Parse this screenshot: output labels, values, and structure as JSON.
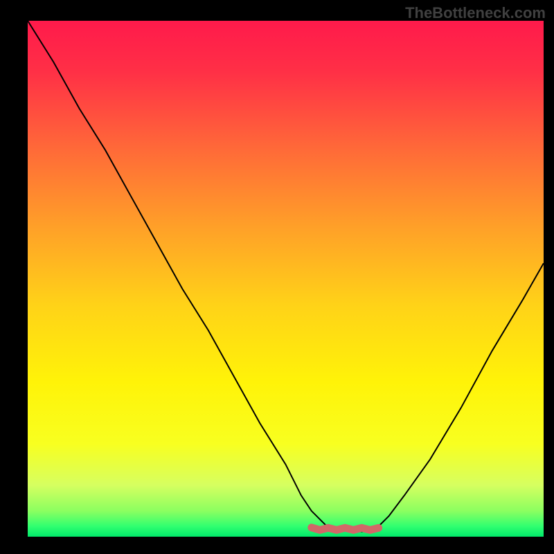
{
  "watermark": "TheBottleneck.com",
  "chart_data": {
    "type": "line",
    "title": "",
    "xlabel": "",
    "ylabel": "",
    "xlim": [
      0,
      100
    ],
    "ylim": [
      0,
      100
    ],
    "description": "Bottleneck severity curve over a red-to-green vertical gradient. Curve drops from top-left to a flat minimum near x≈58-68 then rises toward the right edge. A salmon band marks the flat minimum region. Background gradient encodes severity: red (high) at top → yellow mid → bright green (optimal) at bottom.",
    "series": [
      {
        "name": "bottleneck-severity",
        "x": [
          0,
          5,
          10,
          15,
          20,
          25,
          30,
          35,
          40,
          45,
          50,
          53,
          55,
          58,
          62,
          66,
          68,
          70,
          73,
          78,
          84,
          90,
          96,
          100
        ],
        "y": [
          100,
          92,
          83,
          75,
          66,
          57,
          48,
          40,
          31,
          22,
          14,
          8,
          5,
          2,
          1,
          1,
          2,
          4,
          8,
          15,
          25,
          36,
          46,
          53
        ]
      }
    ],
    "annotations": [
      {
        "name": "sweet-spot",
        "x_range": [
          55,
          68
        ],
        "y": 1.5,
        "color": "#d16868"
      }
    ],
    "gradient_stops": [
      {
        "pos": 0.0,
        "color": "#ff1a4b"
      },
      {
        "pos": 0.1,
        "color": "#ff3046"
      },
      {
        "pos": 0.25,
        "color": "#ff6a38"
      },
      {
        "pos": 0.4,
        "color": "#ffa028"
      },
      {
        "pos": 0.55,
        "color": "#ffd218"
      },
      {
        "pos": 0.7,
        "color": "#fff308"
      },
      {
        "pos": 0.82,
        "color": "#f8ff20"
      },
      {
        "pos": 0.9,
        "color": "#d6ff60"
      },
      {
        "pos": 0.95,
        "color": "#8cff60"
      },
      {
        "pos": 0.98,
        "color": "#30ff70"
      },
      {
        "pos": 1.0,
        "color": "#00e86a"
      }
    ]
  }
}
